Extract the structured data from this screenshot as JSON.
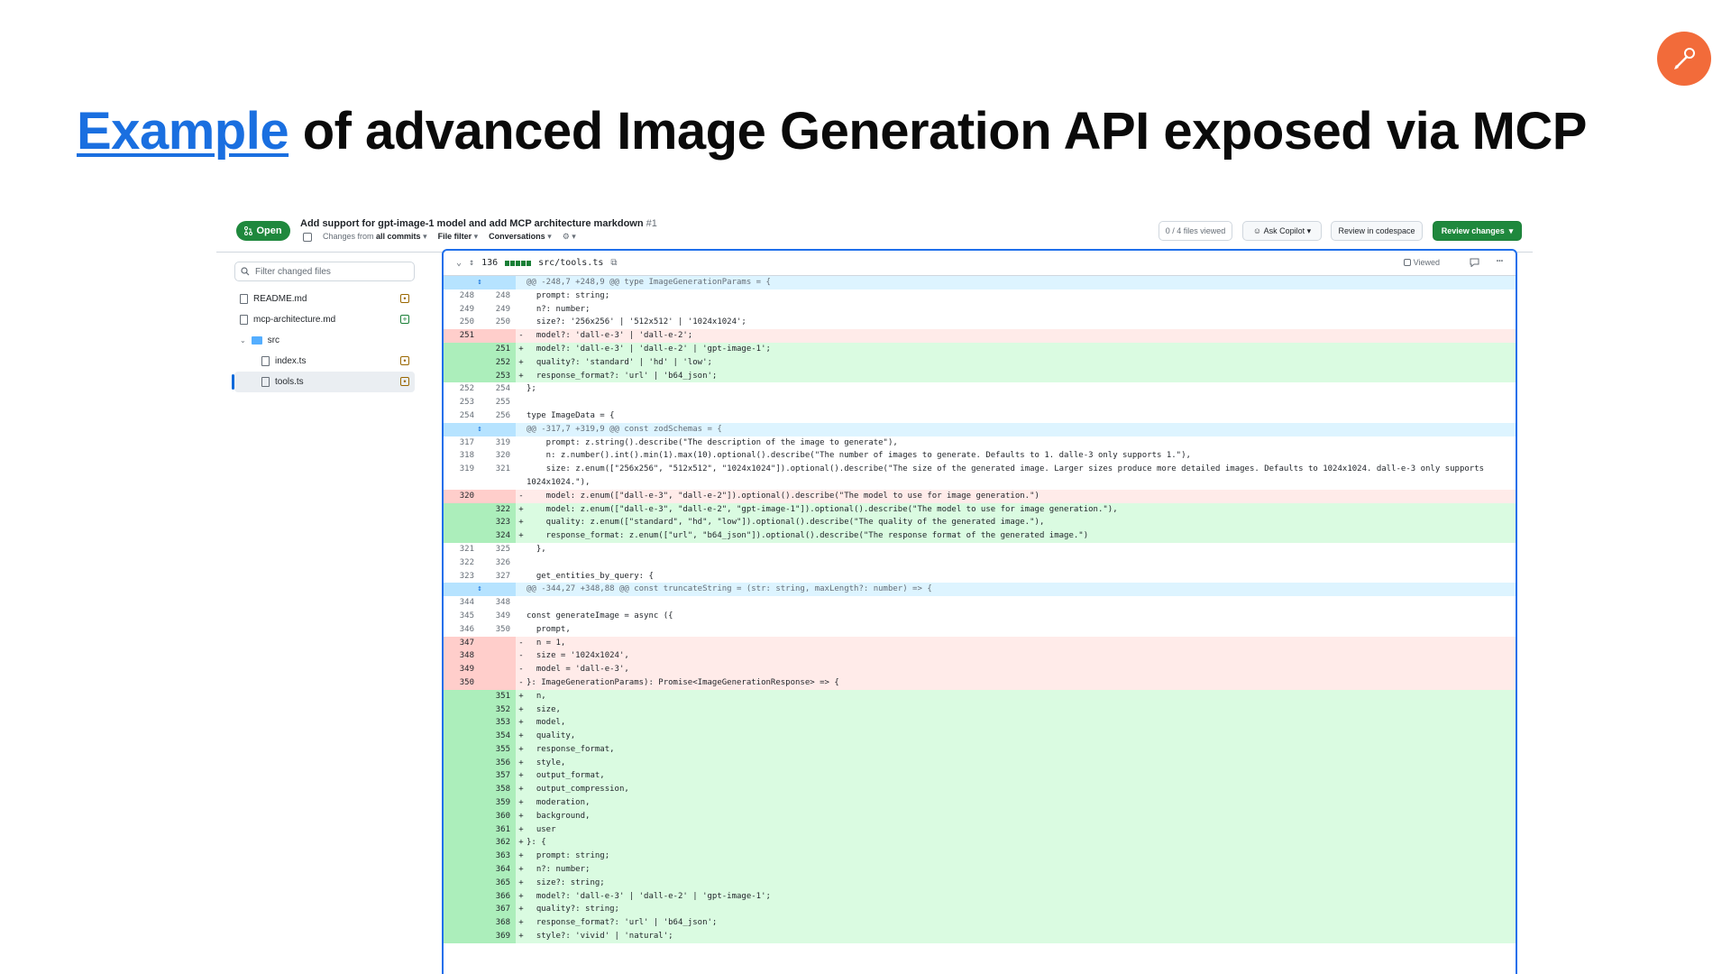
{
  "slide": {
    "title_link": "Example",
    "title_rest": " of advanced Image Generation API exposed via MCP"
  },
  "pr": {
    "state": "Open",
    "title": "Add support for gpt-image-1 model and add MCP architecture markdown",
    "number": "#1",
    "changes_from_prefix": "Changes from",
    "changes_from_value": "all commits",
    "file_filter": "File filter",
    "conversations": "Conversations",
    "files_viewed": "0 / 4 files viewed",
    "ask_copilot": "Ask Copilot",
    "review_in_codespace": "Review in codespace",
    "review_changes": "Review changes"
  },
  "tree": {
    "filter_placeholder": "Filter changed files",
    "items": [
      {
        "label": "README.md",
        "kind": "file",
        "status": "modified"
      },
      {
        "label": "mcp-architecture.md",
        "kind": "file",
        "status": "added"
      },
      {
        "label": "src",
        "kind": "folder",
        "status": ""
      },
      {
        "label": "index.ts",
        "kind": "file",
        "status": "modified"
      },
      {
        "label": "tools.ts",
        "kind": "file",
        "status": "modified"
      }
    ]
  },
  "diff": {
    "changes_count": "136",
    "file_path": "src/tools.ts",
    "viewed_label": "Viewed",
    "rows": [
      {
        "t": "hunk",
        "a": "",
        "b": "",
        "s": "",
        "c": "@@ -248,7 +248,9 @@ type ImageGenerationParams = {"
      },
      {
        "t": "ctx",
        "a": "248",
        "b": "248",
        "s": "",
        "c": "  prompt: string;"
      },
      {
        "t": "ctx",
        "a": "249",
        "b": "249",
        "s": "",
        "c": "  n?: number;"
      },
      {
        "t": "ctx",
        "a": "250",
        "b": "250",
        "s": "",
        "c": "  size?: '256x256' | '512x512' | '1024x1024';"
      },
      {
        "t": "del",
        "a": "251",
        "b": "",
        "s": "-",
        "c": "  model?: 'dall-e-3' | 'dall-e-2';"
      },
      {
        "t": "add",
        "a": "",
        "b": "251",
        "s": "+",
        "c": "  model?: 'dall-e-3' | 'dall-e-2' | 'gpt-image-1';"
      },
      {
        "t": "add",
        "a": "",
        "b": "252",
        "s": "+",
        "c": "  quality?: 'standard' | 'hd' | 'low';"
      },
      {
        "t": "add",
        "a": "",
        "b": "253",
        "s": "+",
        "c": "  response_format?: 'url' | 'b64_json';"
      },
      {
        "t": "ctx",
        "a": "252",
        "b": "254",
        "s": "",
        "c": "};"
      },
      {
        "t": "ctx",
        "a": "253",
        "b": "255",
        "s": "",
        "c": ""
      },
      {
        "t": "ctx",
        "a": "254",
        "b": "256",
        "s": "",
        "c": "type ImageData = {"
      },
      {
        "t": "hunk",
        "a": "",
        "b": "",
        "s": "",
        "c": "@@ -317,7 +319,9 @@ const zodSchemas = {"
      },
      {
        "t": "ctx",
        "a": "317",
        "b": "319",
        "s": "",
        "c": "    prompt: z.string().describe(\"The description of the image to generate\"),"
      },
      {
        "t": "ctx",
        "a": "318",
        "b": "320",
        "s": "",
        "c": "    n: z.number().int().min(1).max(10).optional().describe(\"The number of images to generate. Defaults to 1. dalle-3 only supports 1.\"),"
      },
      {
        "t": "wrap",
        "a": "319",
        "b": "321",
        "s": "",
        "c": "    size: z.enum([\"256x256\", \"512x512\", \"1024x1024\"]).optional().describe(\"The size of the generated image. Larger sizes produce more detailed images. Defaults to 1024x1024. dall-e-3 only supports 1024x1024.\"),"
      },
      {
        "t": "del",
        "a": "320",
        "b": "",
        "s": "-",
        "c": "    model: z.enum([\"dall-e-3\", \"dall-e-2\"]).optional().describe(\"The model to use for image generation.\")"
      },
      {
        "t": "add",
        "a": "",
        "b": "322",
        "s": "+",
        "c": "    model: z.enum([\"dall-e-3\", \"dall-e-2\", \"gpt-image-1\"]).optional().describe(\"The model to use for image generation.\"),"
      },
      {
        "t": "add",
        "a": "",
        "b": "323",
        "s": "+",
        "c": "    quality: z.enum([\"standard\", \"hd\", \"low\"]).optional().describe(\"The quality of the generated image.\"),"
      },
      {
        "t": "add",
        "a": "",
        "b": "324",
        "s": "+",
        "c": "    response_format: z.enum([\"url\", \"b64_json\"]).optional().describe(\"The response format of the generated image.\")"
      },
      {
        "t": "ctx",
        "a": "321",
        "b": "325",
        "s": "",
        "c": "  },"
      },
      {
        "t": "ctx",
        "a": "322",
        "b": "326",
        "s": "",
        "c": ""
      },
      {
        "t": "ctx",
        "a": "323",
        "b": "327",
        "s": "",
        "c": "  get_entities_by_query: {"
      },
      {
        "t": "hunk",
        "a": "",
        "b": "",
        "s": "",
        "c": "@@ -344,27 +348,88 @@ const truncateString = (str: string, maxLength?: number) => {"
      },
      {
        "t": "ctx",
        "a": "344",
        "b": "348",
        "s": "",
        "c": ""
      },
      {
        "t": "ctx",
        "a": "345",
        "b": "349",
        "s": "",
        "c": "const generateImage = async ({"
      },
      {
        "t": "ctx",
        "a": "346",
        "b": "350",
        "s": "",
        "c": "  prompt,"
      },
      {
        "t": "del",
        "a": "347",
        "b": "",
        "s": "-",
        "c": "  n = 1,"
      },
      {
        "t": "del",
        "a": "348",
        "b": "",
        "s": "-",
        "c": "  size = '1024x1024',"
      },
      {
        "t": "del",
        "a": "349",
        "b": "",
        "s": "-",
        "c": "  model = 'dall-e-3',"
      },
      {
        "t": "del",
        "a": "350",
        "b": "",
        "s": "-",
        "c": "}: ImageGenerationParams): Promise<ImageGenerationResponse> => {"
      },
      {
        "t": "add",
        "a": "",
        "b": "351",
        "s": "+",
        "c": "  n,"
      },
      {
        "t": "add",
        "a": "",
        "b": "352",
        "s": "+",
        "c": "  size,"
      },
      {
        "t": "add",
        "a": "",
        "b": "353",
        "s": "+",
        "c": "  model,"
      },
      {
        "t": "add",
        "a": "",
        "b": "354",
        "s": "+",
        "c": "  quality,"
      },
      {
        "t": "add",
        "a": "",
        "b": "355",
        "s": "+",
        "c": "  response_format,"
      },
      {
        "t": "add",
        "a": "",
        "b": "356",
        "s": "+",
        "c": "  style,"
      },
      {
        "t": "add",
        "a": "",
        "b": "357",
        "s": "+",
        "c": "  output_format,"
      },
      {
        "t": "add",
        "a": "",
        "b": "358",
        "s": "+",
        "c": "  output_compression,"
      },
      {
        "t": "add",
        "a": "",
        "b": "359",
        "s": "+",
        "c": "  moderation,"
      },
      {
        "t": "add",
        "a": "",
        "b": "360",
        "s": "+",
        "c": "  background,"
      },
      {
        "t": "add",
        "a": "",
        "b": "361",
        "s": "+",
        "c": "  user"
      },
      {
        "t": "add",
        "a": "",
        "b": "362",
        "s": "+",
        "c": "}: {"
      },
      {
        "t": "add",
        "a": "",
        "b": "363",
        "s": "+",
        "c": "  prompt: string;"
      },
      {
        "t": "add",
        "a": "",
        "b": "364",
        "s": "+",
        "c": "  n?: number;"
      },
      {
        "t": "add",
        "a": "",
        "b": "365",
        "s": "+",
        "c": "  size?: string;"
      },
      {
        "t": "add",
        "a": "",
        "b": "366",
        "s": "+",
        "c": "  model?: 'dall-e-3' | 'dall-e-2' | 'gpt-image-1';"
      },
      {
        "t": "add",
        "a": "",
        "b": "367",
        "s": "+",
        "c": "  quality?: string;"
      },
      {
        "t": "add",
        "a": "",
        "b": "368",
        "s": "+",
        "c": "  response_format?: 'url' | 'b64_json';"
      },
      {
        "t": "add",
        "a": "",
        "b": "369",
        "s": "+",
        "c": "  style?: 'vivid' | 'natural';"
      }
    ]
  }
}
